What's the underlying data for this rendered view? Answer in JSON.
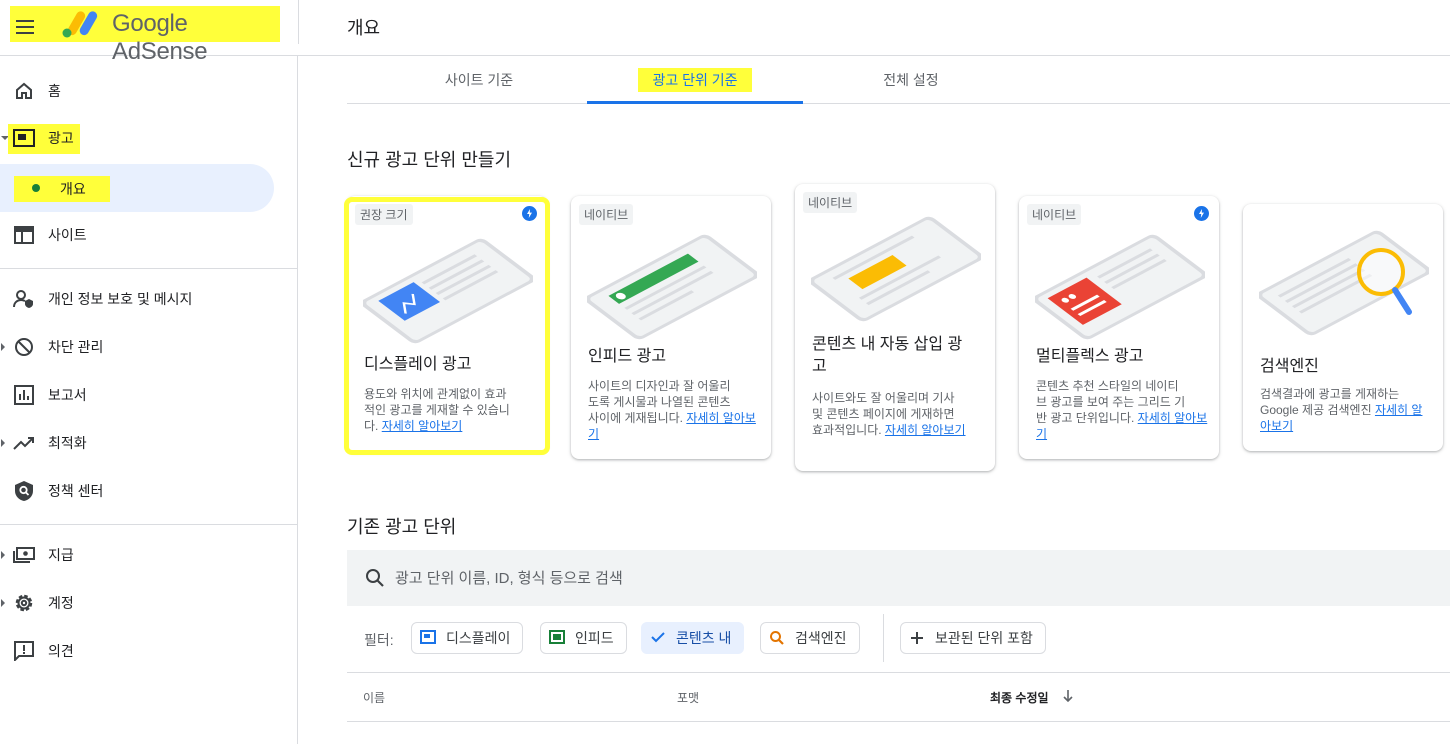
{
  "header": {
    "brand_name": "Google AdSense",
    "page_title": "개요"
  },
  "sidebar": {
    "items": [
      {
        "label": "홈",
        "icon": "home-icon"
      },
      {
        "label": "광고",
        "icon": "ads-icon"
      },
      {
        "label": "개요",
        "icon": "dot-icon"
      },
      {
        "label": "사이트",
        "icon": "sites-icon"
      },
      {
        "label": "개인 정보 보호 및 메시지",
        "icon": "privacy-icon"
      },
      {
        "label": "차단 관리",
        "icon": "block-icon"
      },
      {
        "label": "보고서",
        "icon": "reports-icon"
      },
      {
        "label": "최적화",
        "icon": "optimization-icon"
      },
      {
        "label": "정책 센터",
        "icon": "policy-icon"
      },
      {
        "label": "지급",
        "icon": "payments-icon"
      },
      {
        "label": "계정",
        "icon": "settings-icon"
      },
      {
        "label": "의견",
        "icon": "feedback-icon"
      }
    ]
  },
  "tabs": [
    {
      "label": "사이트 기준"
    },
    {
      "label": "광고 단위 기준",
      "active": true
    },
    {
      "label": "전체 설정"
    }
  ],
  "new_section": {
    "title": "신규 광고 단위 만들기",
    "learn_more": "자세히 알아보기",
    "cards": [
      {
        "badge": "권장 크기",
        "title": "디스플레이 광고",
        "desc_l1": "용도와 위치에 관계없이 효과",
        "desc_l2": "적인 광고를 게재할 수 있습니",
        "desc_l3": "다.",
        "accent": "#4285f4"
      },
      {
        "badge": "네이티브",
        "title": "인피드 광고",
        "desc_l1": "사이트의 디자인과 잘 어울리",
        "desc_l2": "도록 게시물과 나열된 콘텐츠",
        "desc_l3": "사이에 게재됩니다.",
        "accent": "#34a853"
      },
      {
        "badge": "네이티브",
        "title_l1": "콘텐츠 내 자동 삽입 광",
        "title_l2": "고",
        "desc_l1": "사이트와도 잘 어울리며 기사",
        "desc_l2": "및 콘텐츠 페이지에 게재하면",
        "desc_l3": "효과적입니다.",
        "accent": "#fbbc04"
      },
      {
        "badge": "네이티브",
        "title": "멀티플렉스 광고",
        "desc_l1": "콘텐츠 추천 스타일의 네이티",
        "desc_l2": "브 광고를 보여 주는 그리드 기",
        "desc_l3": "반 광고 단위입니다.",
        "accent": "#ea4335"
      },
      {
        "title": "검색엔진",
        "desc_l1": "검색결과에 광고를 게재하는",
        "desc_l2": "Google 제공 검색엔진",
        "accent": "#fbbc04"
      }
    ]
  },
  "existing_section": {
    "title": "기존 광고 단위",
    "search_placeholder": "광고 단위 이름, ID, 형식 등으로 검색",
    "filter_label": "필터:",
    "chips": [
      {
        "label": "디스플레이",
        "color": "#1a73e8"
      },
      {
        "label": "인피드",
        "color": "#188038"
      },
      {
        "label": "콘텐츠 내",
        "selected": true
      },
      {
        "label": "검색엔진",
        "color": "#e37400"
      }
    ],
    "archived_chip": "보관된 단위 포함",
    "columns": {
      "name": "이름",
      "format": "포맷",
      "modified": "최종 수정일"
    }
  }
}
